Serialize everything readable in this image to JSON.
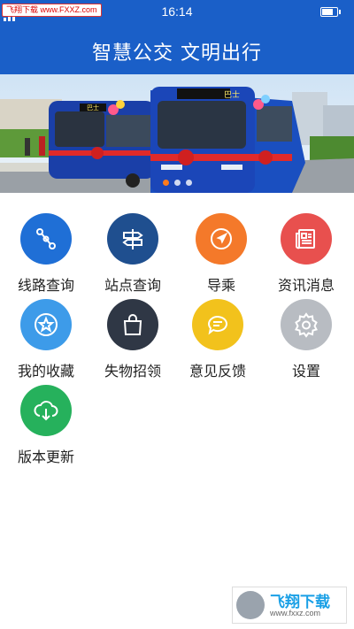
{
  "status_bar": {
    "time": "16:14",
    "watermark": "飞翔下载 www.FXXZ.com",
    "battery_level": 0.85
  },
  "header": {
    "title": "智慧公交 文明出行"
  },
  "banner": {
    "bus_sign_left": "巴士",
    "bus_sign_right": "巴士",
    "slide_count": 3,
    "active_slide": 1
  },
  "menu": {
    "items": [
      {
        "label": "线路查询",
        "icon": "route-icon",
        "color": "#1f6fd6"
      },
      {
        "label": "站点查询",
        "icon": "signpost-icon",
        "color": "#1f4f8f"
      },
      {
        "label": "导乘",
        "icon": "navigation-arrow-icon",
        "color": "#f4792a"
      },
      {
        "label": "资讯消息",
        "icon": "newspaper-icon",
        "color": "#e8504e"
      },
      {
        "label": "我的收藏",
        "icon": "star-icon",
        "color": "#3d9be9"
      },
      {
        "label": "失物招领",
        "icon": "shopping-bag-icon",
        "color": "#2f3745"
      },
      {
        "label": "意见反馈",
        "icon": "chat-bubble-icon",
        "color": "#f2c21c"
      },
      {
        "label": "设置",
        "icon": "gear-icon",
        "color": "#b8bcc2"
      },
      {
        "label": "版本更新",
        "icon": "cloud-download-icon",
        "color": "#26b15c"
      }
    ]
  },
  "bottom_watermark": {
    "name": "飞翔下载",
    "url": "www.fxxz.com"
  }
}
